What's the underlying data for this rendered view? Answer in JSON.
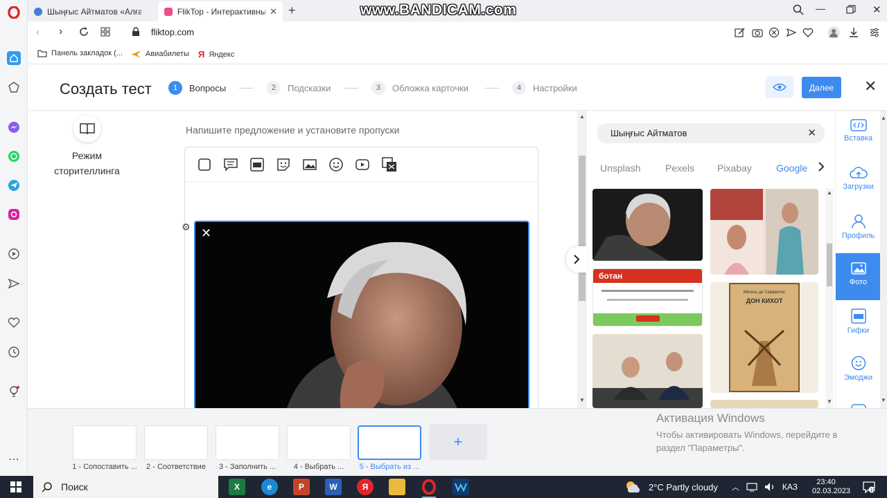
{
  "browser": {
    "tabs": [
      {
        "title": "Шыңғыс Айтматов «Алғаш",
        "active": false
      },
      {
        "title": "FlikTop - Интерактивный",
        "active": true
      }
    ],
    "url": "fliktop.com",
    "bookmarks": [
      {
        "label": "Панель закладок (..."
      },
      {
        "label": "Авиабилеты"
      },
      {
        "label": "Яндекс"
      }
    ],
    "watermark": "www.BANDICAM.com"
  },
  "header": {
    "title": "Создать тест",
    "steps": [
      {
        "num": "1",
        "label": "Вопросы",
        "active": true
      },
      {
        "num": "2",
        "label": "Подсказки",
        "active": false
      },
      {
        "num": "3",
        "label": "Обложка карточки",
        "active": false
      },
      {
        "num": "4",
        "label": "Настройки",
        "active": false
      }
    ],
    "next_label": "Далее"
  },
  "editor": {
    "storytelling_label": "Режим сторителлинга",
    "hint": "Напишите предложение и установите пропуски"
  },
  "image_panel": {
    "search_value": "Шыңғыс Айтматов",
    "sources": [
      {
        "label": "Unsplash",
        "active": false
      },
      {
        "label": "Pexels",
        "active": false
      },
      {
        "label": "Pixabay",
        "active": false
      },
      {
        "label": "Google",
        "active": true
      }
    ],
    "thumb_texts": {
      "botan_logo": "ботан",
      "book_title": "ДОН КИХОТ",
      "book_author": "Мигель де Сервантес"
    }
  },
  "right_menu": [
    {
      "label": "Вставка",
      "icon": "code-icon",
      "active": false
    },
    {
      "label": "Загрузки",
      "icon": "cloud-upload-icon",
      "active": false
    },
    {
      "label": "Профиль",
      "icon": "user-icon",
      "active": false
    },
    {
      "label": "Фото",
      "icon": "photo-icon",
      "active": true
    },
    {
      "label": "Гифки",
      "icon": "gif-icon",
      "active": false
    },
    {
      "label": "Эмоджи",
      "icon": "smile-icon",
      "active": false
    }
  ],
  "slides": [
    {
      "label": "1 - Сопоставить ...",
      "active": false
    },
    {
      "label": "2 - Соответствие",
      "active": false
    },
    {
      "label": "3 - Заполнить ...",
      "active": false
    },
    {
      "label": "4 - Выбрать ...",
      "active": false
    },
    {
      "label": "5 - Выбрать из ...",
      "active": true
    }
  ],
  "add_slide_label": "+",
  "windows_activation": {
    "title": "Активация Windows",
    "subtitle": "Чтобы активировать Windows, перейдите в раздел \"Параметры\"."
  },
  "taskbar": {
    "search_label": "Поиск",
    "weather": "2°C  Partly cloudy",
    "language": "КАЗ",
    "time": "23:40",
    "date": "02.03.2023"
  },
  "colors": {
    "accent": "#3d8bef",
    "taskbar": "#1f2532",
    "opera_red": "#e0262a"
  }
}
